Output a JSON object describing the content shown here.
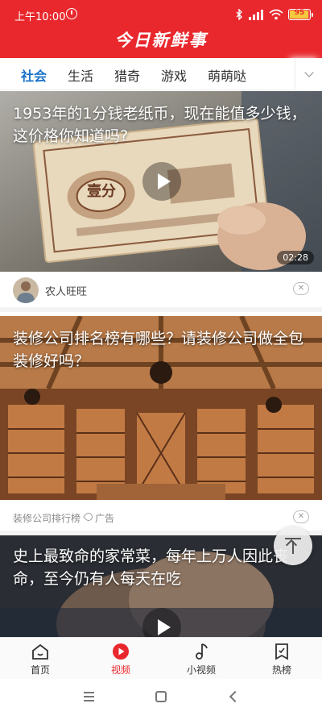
{
  "status": {
    "time": "上午10:00",
    "battery": "95",
    "battery_level": 0.95
  },
  "header": {
    "title": "今日新鲜事"
  },
  "tabs": [
    {
      "label": "社会",
      "active": true
    },
    {
      "label": "生活"
    },
    {
      "label": "猎奇"
    },
    {
      "label": "游戏"
    },
    {
      "label": "萌萌哒"
    }
  ],
  "feed": [
    {
      "title": "1953年的1分钱老纸币，现在能值多少钱，这价格你知道吗?",
      "duration": "02:28",
      "author": "农人旺旺",
      "banknote_text": "壹分"
    },
    {
      "title": "装修公司排名榜有哪些？请装修公司做全包装修好吗？",
      "source": "装修公司排行榜",
      "ad_label": "广告"
    },
    {
      "title": "史上最致命的家常菜，每年上万人因此丧命，至今仍有人每天在吃"
    }
  ],
  "bottom_nav": [
    {
      "label": "首页",
      "icon": "home-icon"
    },
    {
      "label": "视频",
      "icon": "video-icon",
      "active": true
    },
    {
      "label": "小视频",
      "icon": "music-note-icon"
    },
    {
      "label": "热榜",
      "icon": "hot-list-icon"
    }
  ],
  "colors": {
    "brand": "#e9282d",
    "tab_active": "#1a73c9"
  }
}
